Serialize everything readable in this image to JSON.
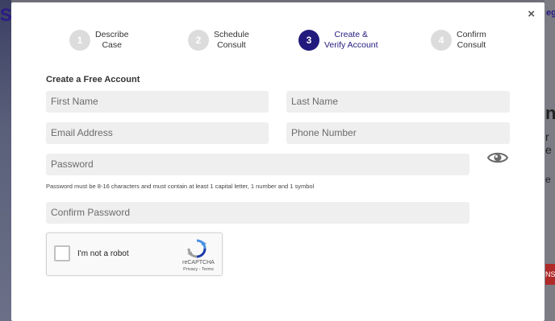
{
  "background": {
    "right_text": "egi",
    "right_big": "ne",
    "right_small": "r e",
    "right_e": "e",
    "right_btn": "NS"
  },
  "modal": {
    "close": "×",
    "steps": [
      {
        "number": "1",
        "line1": "Describe",
        "line2": "Case"
      },
      {
        "number": "2",
        "line1": "Schedule",
        "line2": "Consult"
      },
      {
        "number": "3",
        "line1": "Create &",
        "line2": "Verify Account"
      },
      {
        "number": "4",
        "line1": "Confirm",
        "line2": "Consult"
      }
    ],
    "active_step": 3,
    "title": "Create a Free Account",
    "fields": {
      "first_name": "First Name",
      "last_name": "Last Name",
      "email": "Email Address",
      "phone": "Phone Number",
      "password": "Password",
      "confirm_password": "Confirm Password"
    },
    "password_hint": "Password must be 8-16 characters and must contain at least 1 capital letter, 1 number and 1 symbol",
    "recaptcha": {
      "label": "I'm not a robot",
      "brand": "reCAPTCHA",
      "links": "Privacy - Terms"
    }
  },
  "colors": {
    "accent": "#221a7c",
    "field_bg": "#efefef",
    "overlay": "#6d6e78"
  }
}
